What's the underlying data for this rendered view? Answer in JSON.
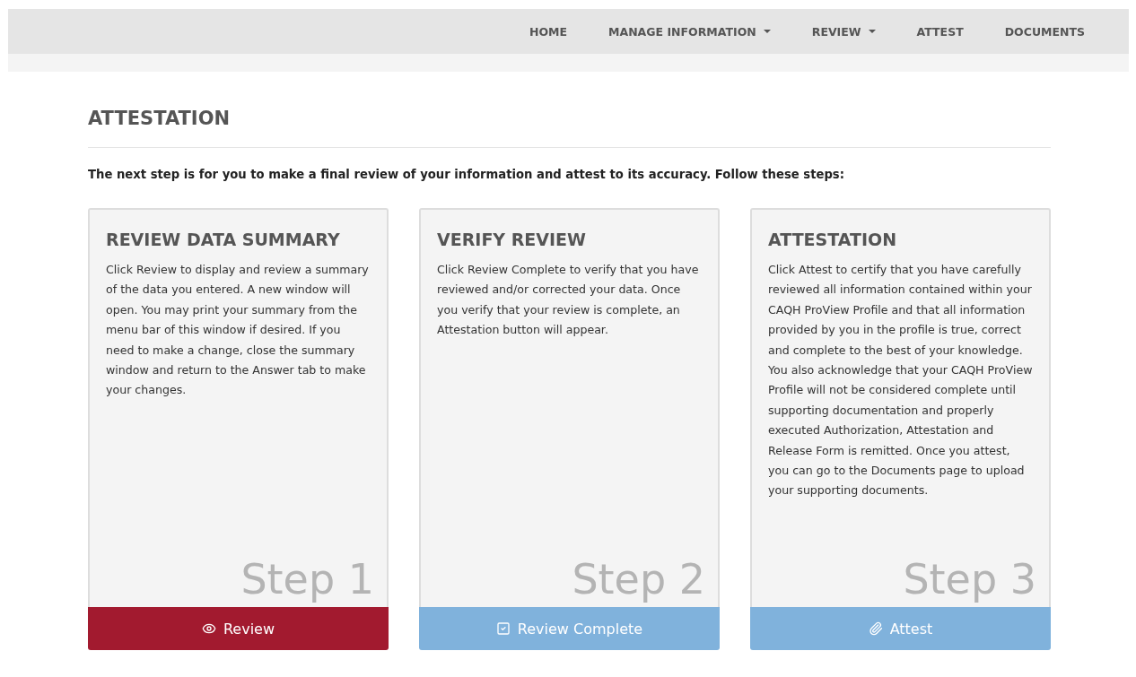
{
  "nav": [
    {
      "label": "HOME",
      "dropdown": false
    },
    {
      "label": "MANAGE INFORMATION",
      "dropdown": true
    },
    {
      "label": "REVIEW",
      "dropdown": true
    },
    {
      "label": "ATTEST",
      "dropdown": false
    },
    {
      "label": "DOCUMENTS",
      "dropdown": false
    }
  ],
  "page": {
    "title": "ATTESTATION",
    "intro": "The next step is for you to make a final review of your information and attest to its accuracy. Follow these steps:"
  },
  "steps": [
    {
      "title": "REVIEW DATA SUMMARY",
      "text": "Click Review to display and review a summary of the data you entered. A new window will open. You may print your summary from the menu bar of this window if desired. If you need to make a change, close the summary window and return to the Answer tab to make your changes.",
      "step": "Step 1",
      "button": {
        "label": "Review",
        "disabled": false
      }
    },
    {
      "title": "VERIFY REVIEW",
      "text": "Click Review Complete to verify that you have reviewed and/or corrected your data. Once you verify that your review is complete, an Attestation button will appear.",
      "step": "Step 2",
      "button": {
        "label": "Review Complete",
        "disabled": true
      }
    },
    {
      "title": "ATTESTATION",
      "text": "Click Attest to certify that you have carefully reviewed all information contained within your CAQH ProView Profile and that all information provided by you in the profile is true, correct and complete to the best of your knowledge. You also acknowledge that your CAQH ProView Profile will not be considered complete until supporting documentation and properly executed Authorization, Attestation and Release Form is remitted. Once you attest, you can go to the Documents page to upload your supporting documents.",
      "step": "Step 3",
      "button": {
        "label": "Attest",
        "disabled": true
      }
    }
  ]
}
